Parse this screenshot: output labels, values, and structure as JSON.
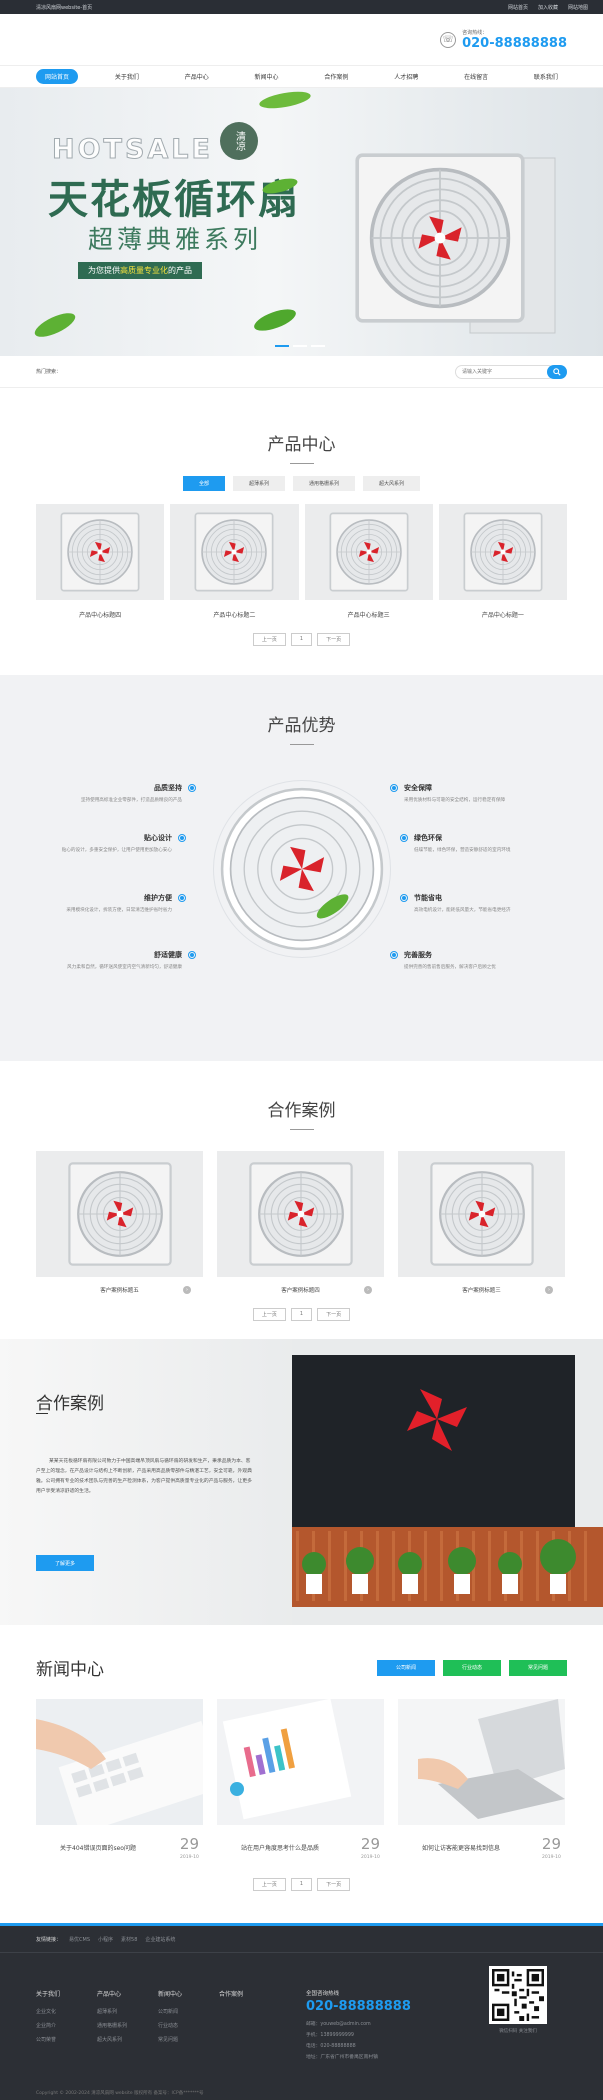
{
  "topbar": {
    "welcome": "清凉风扇网website-首页",
    "links": [
      "网站首页",
      "加入收藏",
      "网站地图"
    ]
  },
  "header": {
    "hotline_label": "咨询热线：",
    "hotline_number": "020-88888888"
  },
  "nav": {
    "items": [
      "网站首页",
      "关于我们",
      "产品中心",
      "新闻中心",
      "合作案例",
      "人才招聘",
      "在线留言",
      "联系我们"
    ]
  },
  "hero": {
    "hotsale": "HOTSALE",
    "badge": "清凉",
    "title": "天花板循环扇",
    "subtitle": "超薄典雅系列",
    "tagline_before": "为您提供",
    "tagline_highlight": "高质量专业化",
    "tagline_after": "的产品"
  },
  "search": {
    "hot_label": "热门搜索：",
    "placeholder": "请输入关键字"
  },
  "products": {
    "title": "产品中心",
    "tabs": [
      "全部",
      "超薄系列",
      "通用格栅系列",
      "超大风系列"
    ],
    "items": [
      "产品中心标题四",
      "产品中心标题二",
      "产品中心标题三",
      "产品中心标题一"
    ],
    "pager": [
      "上一页",
      "1",
      "下一页"
    ]
  },
  "advantage": {
    "title": "产品优势",
    "left": [
      {
        "title": "品质坚持",
        "desc": "坚持使用高标准企业零部件，打造品质精良的产品"
      },
      {
        "title": "贴心设计",
        "desc": "贴心的设计，多重安全保护，让用户使用更加放心安心"
      },
      {
        "title": "维护方便",
        "desc": "采用模块化设计，拆装方便，日常清洁维护省时省力"
      },
      {
        "title": "舒适健康",
        "desc": "风力柔和自然，循环送风使室内空气清新均匀，舒适健康"
      }
    ],
    "right": [
      {
        "title": "安全保障",
        "desc": "采用优质材料与可靠的安全结构，运行稳定有保障"
      },
      {
        "title": "绿色环保",
        "desc": "低噪节能，绿色环保，营造安静舒适的室内环境"
      },
      {
        "title": "节能省电",
        "desc": "高效电机设计，能耗低风量大，节能省电更经济"
      },
      {
        "title": "完善服务",
        "desc": "提供完善的售前售后服务，解决客户后顾之忧"
      }
    ]
  },
  "cases": {
    "title": "合作案例",
    "items": [
      "客户案例标题五",
      "客户案例标题四",
      "客户案例标题三"
    ],
    "pager": [
      "上一页",
      "1",
      "下一页"
    ]
  },
  "about": {
    "title": "合作案例",
    "text": "某某天花板循环扇有限公司致力于中国高端吊顶风扇与循环扇的研发和生产，秉承品质为本、客户至上的理念，在产品设计与结构上不断创新，产品采用高品质零部件与精湛工艺，安全可靠，外观典雅。公司拥有专业的技术团队与完善的生产检测体系，为客户提供高质量专业化的产品与服务，让更多用户享受清凉舒适的生活。",
    "button": "了解更多"
  },
  "news": {
    "title": "新闻中心",
    "tabs": [
      "公司新闻",
      "行业动态",
      "常见问题"
    ],
    "tab_colors": [
      "#1e9bf0",
      "#1fbf57",
      "#1fbf57"
    ],
    "items": [
      {
        "title": "关于404错误页面的seo问题",
        "day": "29",
        "ym": "2019-10"
      },
      {
        "title": "站在用户角度思考什么是品质",
        "day": "29",
        "ym": "2019-10"
      },
      {
        "title": "如何让访客能更容易找到信息",
        "day": "29",
        "ym": "2019-10"
      }
    ],
    "pager": [
      "上一页",
      "1",
      "下一页"
    ]
  },
  "footer": {
    "links_label": "友情链接：",
    "links": [
      "易优CMS",
      "小程序",
      "素材58",
      "企业建站系统"
    ],
    "cols": [
      {
        "title": "关于我们",
        "items": [
          "企业文化",
          "企业简介",
          "公司荣誉"
        ]
      },
      {
        "title": "产品中心",
        "items": [
          "超薄系列",
          "通用格栅系列",
          "超大风系列"
        ]
      },
      {
        "title": "新闻中心",
        "items": [
          "公司新闻",
          "行业动态",
          "常见问题"
        ]
      },
      {
        "title": "合作案例",
        "items": []
      }
    ],
    "contact": {
      "label": "全国咨询热线",
      "number": "020-88888888",
      "email": "邮箱：youweb@admin.com",
      "phone": "手机：13899999999",
      "tel": "电话：020-88888888",
      "address": "地址：广东省广州市番禺区南村镇"
    },
    "qr_caption": "微信扫码 关注我们",
    "copyright": "Copyright © 2002-2024 清凉风扇网 website 版权所有  备案号：ICP备*******号"
  }
}
